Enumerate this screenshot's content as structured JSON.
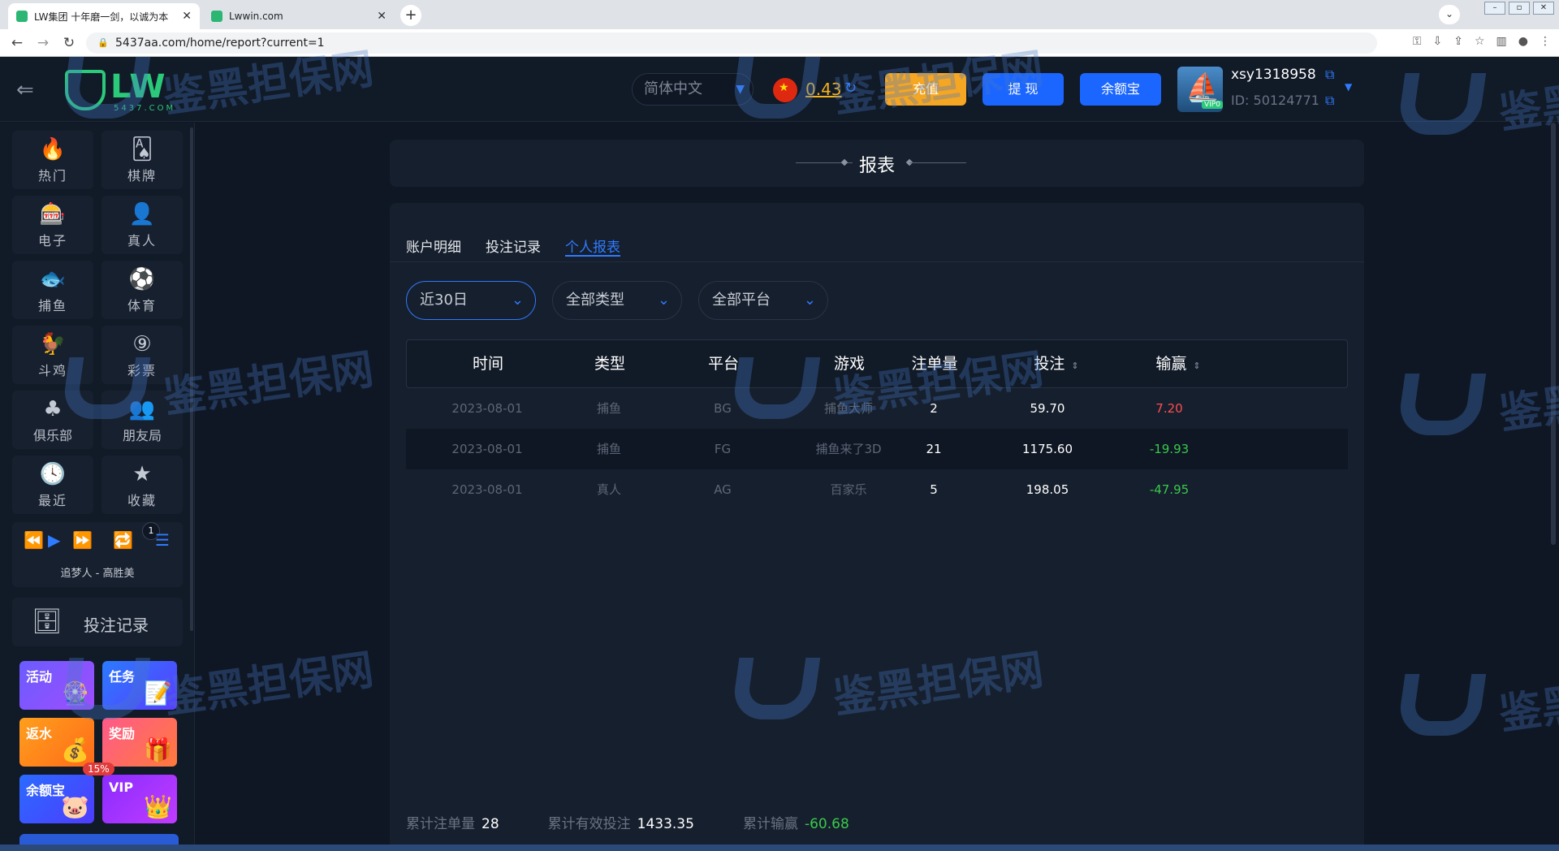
{
  "browser": {
    "tabs": [
      {
        "title": "LW集团 十年磨一剑，以诚为本",
        "active": true
      },
      {
        "title": "Lwwin.com",
        "active": false
      }
    ],
    "url": "5437aa.com/home/report?current=1"
  },
  "header": {
    "logo_text": "LW",
    "logo_sub": "5437.COM",
    "language": "简体中文",
    "balance": "0.43",
    "deposit_label": "充值",
    "withdraw_label": "提 现",
    "yuebao_label": "余额宝",
    "username": "xsy1318958",
    "user_id": "ID: 50124771",
    "vip_badge": "VIP0"
  },
  "sidebar": {
    "categories": [
      {
        "label": "热门",
        "icon": "fire-icon",
        "glyph": "🔥"
      },
      {
        "label": "棋牌",
        "icon": "cards-icon",
        "glyph": "🂡"
      },
      {
        "label": "电子",
        "icon": "slot-icon",
        "glyph": "🎰"
      },
      {
        "label": "真人",
        "icon": "dealer-icon",
        "glyph": "👤"
      },
      {
        "label": "捕鱼",
        "icon": "fish-icon",
        "glyph": "🐟"
      },
      {
        "label": "体育",
        "icon": "soccer-icon",
        "glyph": "⚽"
      },
      {
        "label": "斗鸡",
        "icon": "rooster-icon",
        "glyph": "🐓"
      },
      {
        "label": "彩票",
        "icon": "lottery-icon",
        "glyph": "⑨"
      },
      {
        "label": "俱乐部",
        "icon": "club-icon",
        "glyph": "♣"
      },
      {
        "label": "朋友局",
        "icon": "friends-icon",
        "glyph": "👥"
      },
      {
        "label": "最近",
        "icon": "clock-icon",
        "glyph": "🕓"
      },
      {
        "label": "收藏",
        "icon": "star-icon",
        "glyph": "★"
      }
    ],
    "player": {
      "track": "追梦人 - 高胜美",
      "queue_count": "1"
    },
    "bet_record_label": "投注记录",
    "promos": [
      {
        "label": "活动",
        "glyph": "🎡"
      },
      {
        "label": "任务",
        "glyph": "📝"
      },
      {
        "label": "返水",
        "glyph": "💰"
      },
      {
        "label": "奖励",
        "glyph": "🎁"
      },
      {
        "label": "余额宝",
        "glyph": "🐷"
      },
      {
        "label": "VIP",
        "glyph": "👑"
      }
    ],
    "rebate_badge": "15%"
  },
  "page": {
    "title": "报表",
    "tabs": [
      {
        "label": "账户明细",
        "active": false
      },
      {
        "label": "投注记录",
        "active": false
      },
      {
        "label": "个人报表",
        "active": true
      }
    ],
    "filters": {
      "period": "近30日",
      "type": "全部类型",
      "platform": "全部平台"
    },
    "table": {
      "columns": [
        "时间",
        "类型",
        "平台",
        "游戏",
        "注单量",
        "投注",
        "输赢"
      ],
      "rows": [
        {
          "date": "2023-08-01",
          "type": "捕鱼",
          "platform": "BG",
          "game": "捕鱼大师",
          "count": "2",
          "bet": "59.70",
          "win": "7.20"
        },
        {
          "date": "2023-08-01",
          "type": "捕鱼",
          "platform": "FG",
          "game": "捕鱼来了3D",
          "count": "21",
          "bet": "1175.60",
          "win": "-19.93"
        },
        {
          "date": "2023-08-01",
          "type": "真人",
          "platform": "AG",
          "game": "百家乐",
          "count": "5",
          "bet": "198.05",
          "win": "-47.95"
        }
      ]
    },
    "summary": {
      "count_label": "累计注单量",
      "count": "28",
      "valid_label": "累计有效投注",
      "valid": "1433.35",
      "win_label": "累计输赢",
      "win": "-60.68"
    }
  },
  "watermark": {
    "text": "鉴黑担保网"
  },
  "colors": {
    "accent": "#2f7bff",
    "deposit": "#f5a623",
    "positive": "#ff4d4f",
    "negative": "#3ac94a",
    "background": "#0f1724"
  }
}
